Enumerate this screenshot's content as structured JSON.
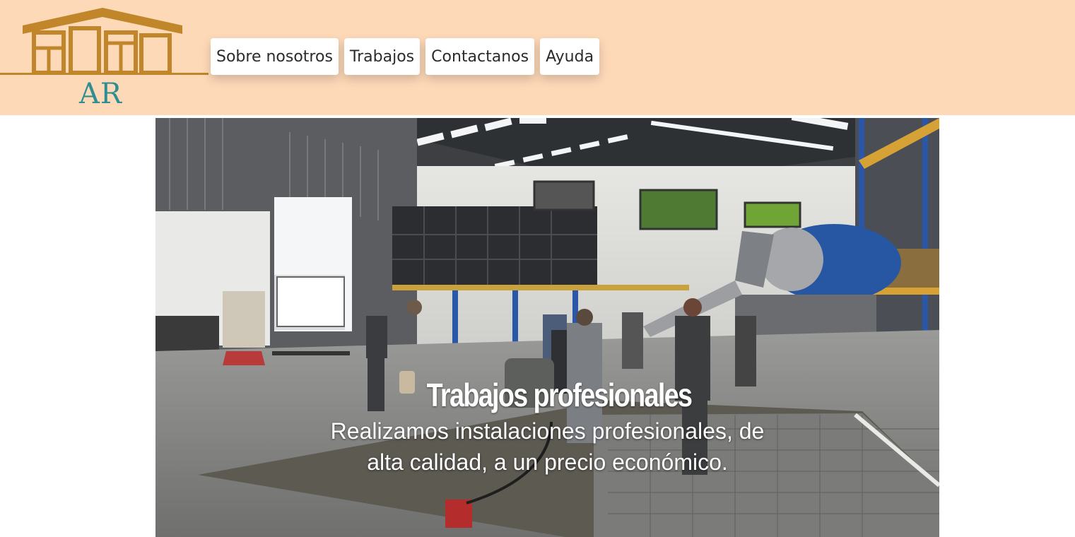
{
  "logo": {
    "text": "AR",
    "icon": "house-logo-icon",
    "color": "#c1862a"
  },
  "nav": {
    "items": [
      {
        "label": "Sobre nosotros"
      },
      {
        "label": "Trabajos"
      },
      {
        "label": "Contactanos"
      },
      {
        "label": "Ayuda"
      }
    ]
  },
  "hero": {
    "title": "Trabajos profesionales",
    "text": "Realizamos instalaciones profesionales, de alta calidad, a un precio económico.",
    "image": "warehouse-concrete-work-photo"
  },
  "colors": {
    "header_bg": "#fdd9b8",
    "logo_gold": "#c1862a",
    "logo_teal": "#2f8e92"
  }
}
